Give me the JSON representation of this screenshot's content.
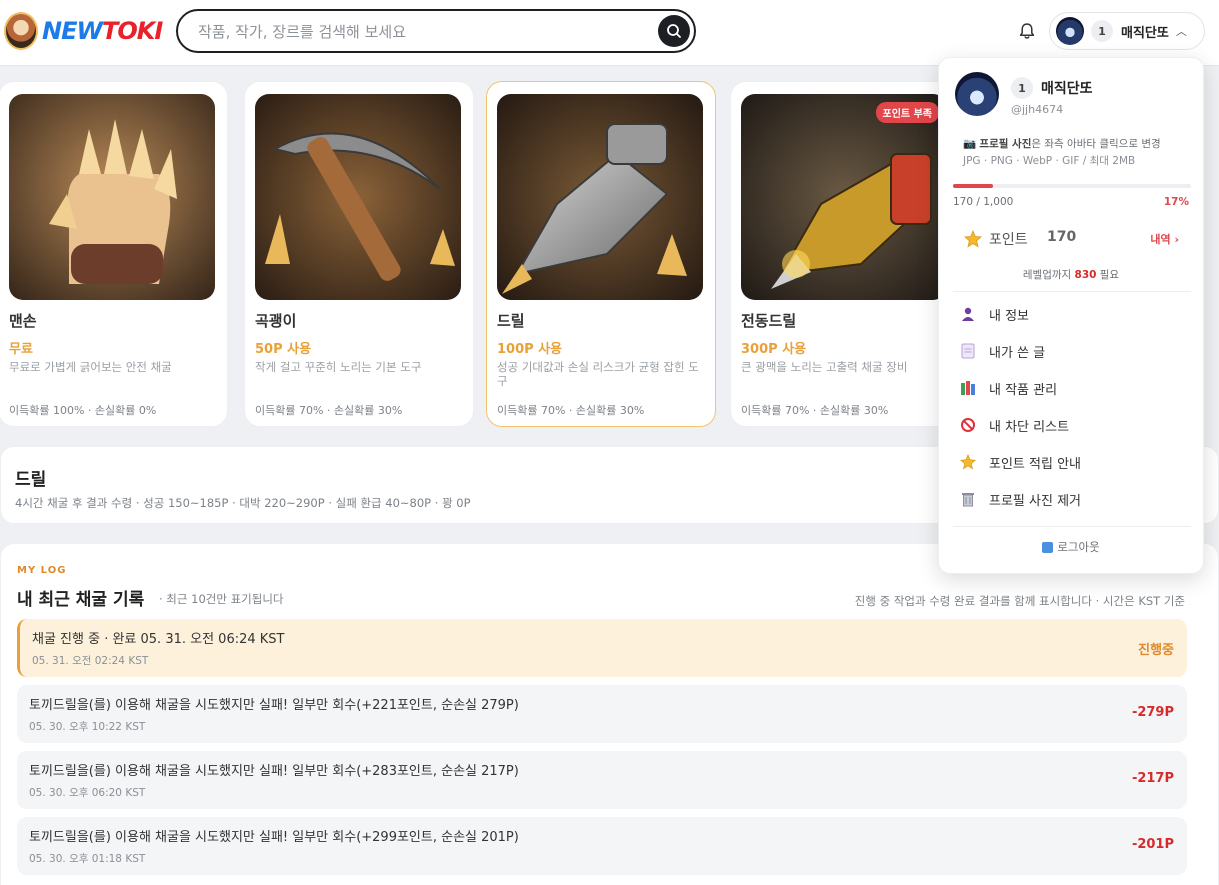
{
  "header": {
    "logo_new": "NEW",
    "logo_toki": "TOKI",
    "search_placeholder": "작품, 작가, 장르를 검색해 보세요",
    "user_level": "1",
    "user_name": "매직단또"
  },
  "tools": [
    {
      "name": "맨손",
      "price": "무료",
      "desc": "무료로 가볍게 긁어보는 안전 채굴",
      "odds": "이득확률 100% · 손실확률 0%",
      "badge": ""
    },
    {
      "name": "곡괭이",
      "price": "50P 사용",
      "desc": "작게 걸고 꾸준히 노리는 기본 도구",
      "odds": "이득확률 70% · 손실확률 30%",
      "badge": ""
    },
    {
      "name": "드릴",
      "price": "100P 사용",
      "desc": "성공 기대값과 손실 리스크가 균형 잡힌 도구",
      "odds": "이득확률 70% · 손실확률 30%",
      "badge": ""
    },
    {
      "name": "전동드릴",
      "price": "300P 사용",
      "desc": "큰 광맥을 노리는 고출력 채굴 장비",
      "odds": "이득확률 70% · 손실확률 30%",
      "badge": "포인트 부족"
    }
  ],
  "detail": {
    "title": "드릴",
    "sub": "4시간 채굴 후 결과 수령 · 성공 150~185P · 대박 220~290P · 실패 환급 40~80P · 꽝 0P"
  },
  "log": {
    "kicker": "MY LOG",
    "title": "내 최근 채굴 기록",
    "note": "· 최근 10건만 표기됩니다",
    "right_note": "진행 중 작업과 수령 완료 결과를 함께 표시합니다 · 시간은 KST 기준",
    "rows": [
      {
        "main": "채굴 진행 중 · 완료 05. 31. 오전 06:24 KST",
        "time": "05. 31. 오전 02:24 KST",
        "result": "진행중"
      },
      {
        "main": "토끼드릴을(를) 이용해 채굴을 시도했지만 실패! 일부만 회수(+221포인트, 순손실 279P)",
        "time": "05. 30. 오후 10:22 KST",
        "result": "-279P"
      },
      {
        "main": "토끼드릴을(를) 이용해 채굴을 시도했지만 실패! 일부만 회수(+283포인트, 순손실 217P)",
        "time": "05. 30. 오후 06:20 KST",
        "result": "-217P"
      },
      {
        "main": "토끼드릴을(를) 이용해 채굴을 시도했지만 실패! 일부만 회수(+299포인트, 순손실 201P)",
        "time": "05. 30. 오후 01:18 KST",
        "result": "-201P"
      }
    ]
  },
  "dropdown": {
    "level": "1",
    "name": "매직단또",
    "handle": "@jjh4674",
    "photo_label": "프로필 사진",
    "photo_line1_rest": "은 좌측 아바타 클릭으로 변경",
    "photo_line2": "JPG · PNG · WebP · GIF / 최대 2MB",
    "exp_text": "170 / 1,000",
    "exp_percent": "17%",
    "exp_fraction": 0.17,
    "points_label": "포인트",
    "points_value": "170",
    "history_label": "내역 ›",
    "levelup_pre": "레벨업까지 ",
    "levelup_value": "830",
    "levelup_post": " 필요",
    "menu": [
      {
        "label": "내 정보",
        "icon": "person-icon"
      },
      {
        "label": "내가 쓴 글",
        "icon": "document-icon"
      },
      {
        "label": "내 작품 관리",
        "icon": "books-icon"
      },
      {
        "label": "내 차단 리스트",
        "icon": "prohibited-icon"
      },
      {
        "label": "포인트 적립 안내",
        "icon": "star-icon"
      },
      {
        "label": "프로필 사진 제거",
        "icon": "trash-icon"
      }
    ],
    "logout_label": "로그아웃"
  }
}
